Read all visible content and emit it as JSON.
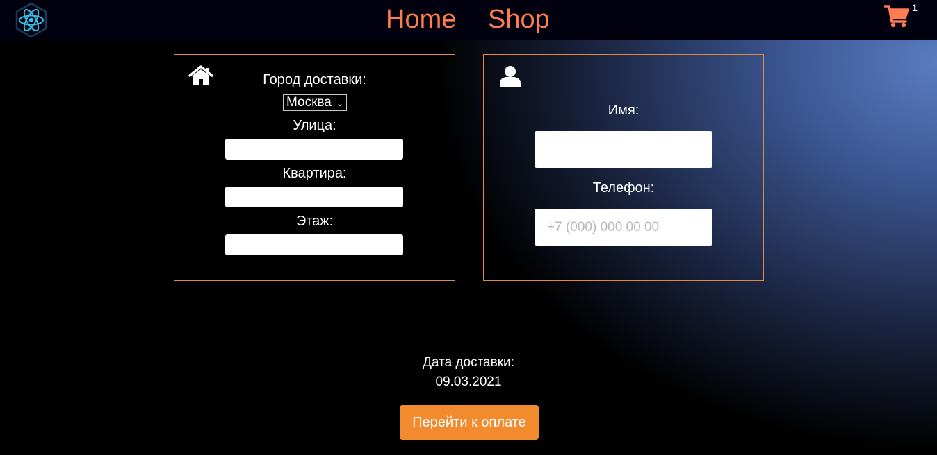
{
  "nav": {
    "home": "Home",
    "shop": "Shop",
    "cart_count": "1"
  },
  "address": {
    "city_label": "Город доставки:",
    "city_value": "Москва",
    "street_label": "Улица:",
    "street_value": "",
    "apartment_label": "Квартира:",
    "apartment_value": "",
    "floor_label": "Этаж:",
    "floor_value": ""
  },
  "contact": {
    "name_label": "Имя:",
    "name_value": "",
    "phone_label": "Телефон:",
    "phone_placeholder": "+7 (000) 000 00 00"
  },
  "delivery": {
    "date_label": "Дата доставки:",
    "date_value": "09.03.2021"
  },
  "actions": {
    "pay": "Перейти к оплате"
  },
  "colors": {
    "accent": "#ff7b50",
    "button": "#f28a2e",
    "panel_border": "#e28a3a",
    "logo": "#2ec4e8"
  },
  "icons": {
    "logo": "react-atom-icon",
    "cart": "cart-icon",
    "address_panel": "home-icon",
    "contact_panel": "user-icon",
    "dropdown": "chevron-down-icon"
  }
}
